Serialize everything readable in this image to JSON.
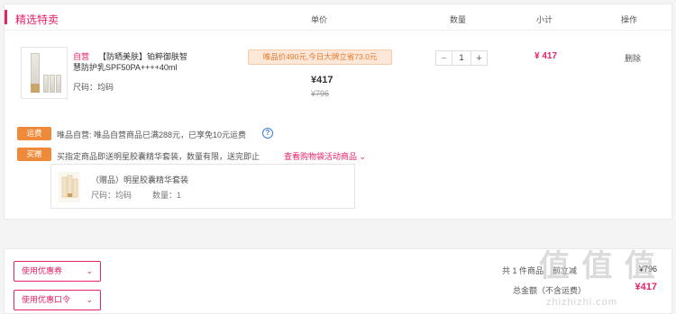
{
  "header": {
    "store_title": "精选特卖",
    "col_price": "单价",
    "col_qty": "数量",
    "col_subtotal": "小计",
    "col_action": "操作"
  },
  "product": {
    "brand_tag": "自营",
    "name_line1": "【防晒美肤】铂粹御肤智",
    "name_line2": "慧防护乳SPF50PA++++40ml",
    "size": "尺码：均码",
    "promo": "唯品价490元,今日大牌立省73.0元",
    "price": "¥417",
    "original_price": "¥796",
    "quantity": "1",
    "minus": "−",
    "plus": "+",
    "subtotal": "¥ 417",
    "delete": "删除"
  },
  "notices": {
    "shipping_tag": "运费",
    "shipping_text": "唯品自营: 唯品自营商品已满288元，已享免10元运费",
    "help_glyph": "?",
    "gift_tag": "买赠",
    "gift_text": "买指定商品即送明星胶囊精华套装，数量有限，送完即止",
    "view_link": "查看购物袋活动商品 ⌄"
  },
  "gift_item": {
    "name": "（赠品）明星胶囊精华套装",
    "size": "尺码：均码",
    "qty": "数量：1"
  },
  "footer": {
    "coupon_btn": "使用优惠券",
    "coupon_code_btn": "使用优惠口令",
    "chevron": "⌄",
    "count_text": "共 1 件商品",
    "count_suffix": "前立减",
    "count_value": "¥796",
    "total_label": "总金额（不含运费）",
    "total_value": "¥417"
  },
  "watermark": {
    "glyphs": "值 值 值",
    "text": "zhizhizhi.com"
  },
  "colors": {
    "accent": "#e5216b",
    "orange_tag": "#f08a3b",
    "promo_bg": "#fde7d8"
  }
}
